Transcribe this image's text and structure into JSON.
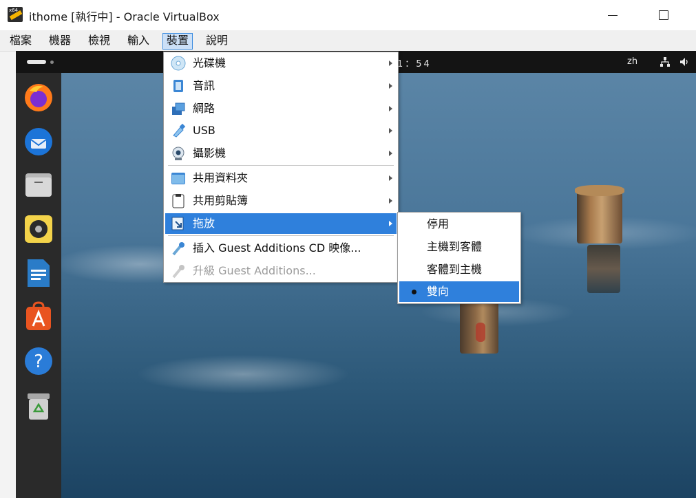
{
  "window": {
    "title": "ithome [執行中] - Oracle VirtualBox",
    "app_icon": "virtualbox-icon",
    "controls": [
      "minimize-icon",
      "maximize-icon"
    ]
  },
  "menubar": {
    "items": [
      "檔案",
      "機器",
      "檢視",
      "輸入",
      "裝置",
      "說明"
    ],
    "active": "裝置"
  },
  "guest_topbar": {
    "clock": "1：54",
    "language": "zh",
    "icons": [
      "network-icon",
      "volume-icon"
    ]
  },
  "dock": {
    "apps": [
      "firefox-icon",
      "thunderbird-icon",
      "files-icon",
      "rhythmbox-icon",
      "libreoffice-writer-icon",
      "app-center-icon",
      "help-icon",
      "trash-icon"
    ]
  },
  "devices_menu": {
    "items": [
      {
        "label": "光碟機",
        "icon": "optical-disc-icon",
        "submenu": true
      },
      {
        "label": "音訊",
        "icon": "audio-icon",
        "submenu": true
      },
      {
        "label": "網路",
        "icon": "network-adapter-icon",
        "submenu": true
      },
      {
        "label": "USB",
        "icon": "usb-icon",
        "submenu": true
      },
      {
        "label": "攝影機",
        "icon": "webcam-icon",
        "submenu": true
      },
      {
        "label": "共用資料夾",
        "icon": "shared-folder-icon",
        "submenu": true
      },
      {
        "label": "共用剪貼簿",
        "icon": "clipboard-icon",
        "submenu": true
      },
      {
        "label": "拖放",
        "icon": "drag-drop-icon",
        "submenu": true,
        "highlighted": true
      },
      {
        "label": "插入 Guest Additions CD 映像...",
        "icon": "guest-additions-icon",
        "submenu": false
      },
      {
        "label": "升級 Guest Additions...",
        "icon": "guest-additions-upgrade-icon",
        "submenu": false,
        "disabled": true
      }
    ]
  },
  "drag_drop_submenu": {
    "items": [
      {
        "label": "停用"
      },
      {
        "label": "主機到客體"
      },
      {
        "label": "客體到主機"
      },
      {
        "label": "雙向",
        "selected": true
      }
    ]
  },
  "colors": {
    "highlight": "#2f80dc",
    "menubar_active_border": "#3d8de0"
  }
}
